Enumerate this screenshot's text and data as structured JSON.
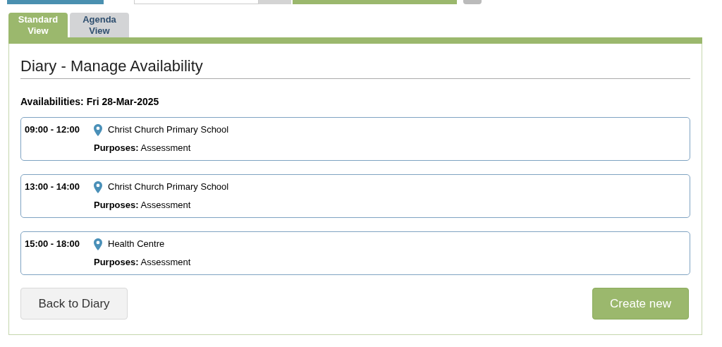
{
  "tabs": [
    {
      "label": "Standard View",
      "selected": true
    },
    {
      "label": "Agenda View",
      "selected": false
    }
  ],
  "title": "Diary - Manage Availability",
  "heading": "Availabilities: Fri 28-Mar-2025",
  "availabilities": [
    {
      "time": "09:00 - 12:00",
      "location": "Christ Church Primary School",
      "purposes_label": "Purposes:",
      "purposes": "Assessment"
    },
    {
      "time": "13:00 - 14:00",
      "location": "Christ Church Primary School",
      "purposes_label": "Purposes:",
      "purposes": "Assessment"
    },
    {
      "time": "15:00 - 18:00",
      "location": "Health Centre",
      "purposes_label": "Purposes:",
      "purposes": "Assessment"
    }
  ],
  "buttons": {
    "back": "Back to Diary",
    "create": "Create new"
  }
}
